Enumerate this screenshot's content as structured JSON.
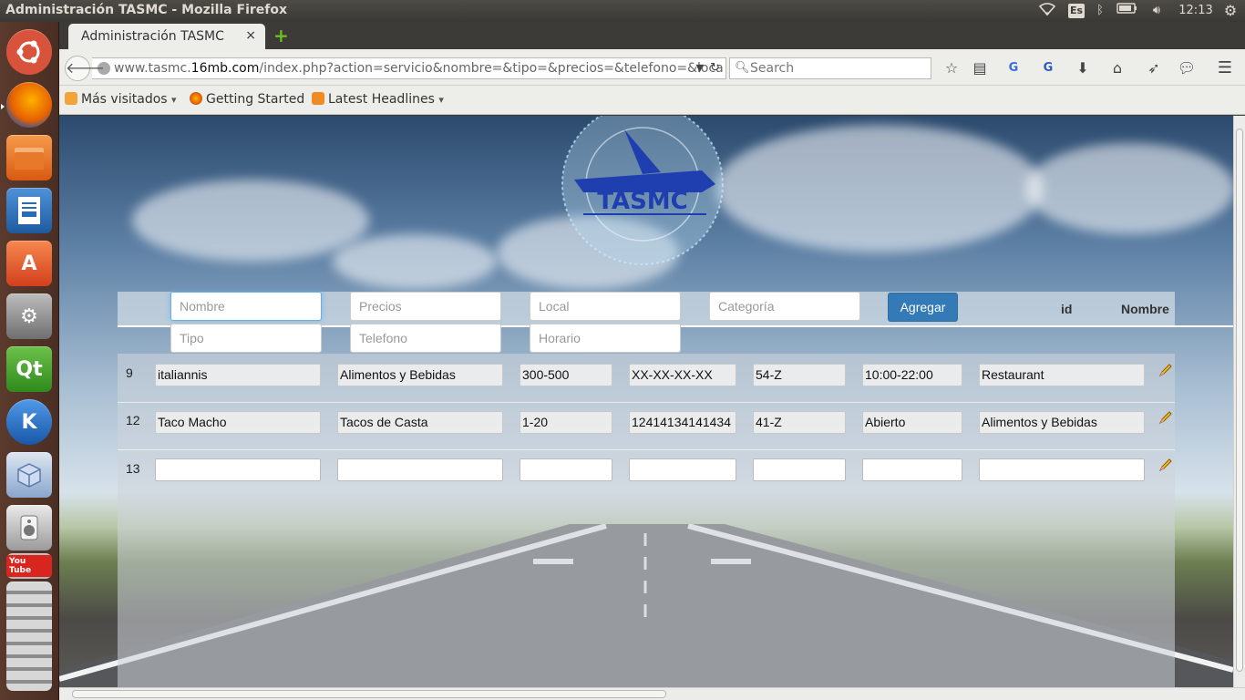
{
  "window": {
    "title": "Administración TASMC - Mozilla Firefox"
  },
  "panel": {
    "keyboard": "Es",
    "time": "12:13"
  },
  "launcher": {
    "items": [
      {
        "name": "ubuntu-dash",
        "color": "#d9533c"
      },
      {
        "name": "firefox",
        "color": "#e66000"
      },
      {
        "name": "files",
        "color": "#e8782a"
      },
      {
        "name": "libreoffice-writer",
        "color": "#2a6cb3"
      },
      {
        "name": "ubuntu-software-center",
        "color": "#e0502e"
      },
      {
        "name": "system-settings",
        "color": "#8a8a8a"
      },
      {
        "name": "qt-creator",
        "color": "#41a02a"
      },
      {
        "name": "kile",
        "color": "#2b74c7"
      },
      {
        "name": "virtualbox",
        "color": "#6b8fbf"
      },
      {
        "name": "speaker",
        "color": "#c9c9c9"
      }
    ],
    "qt_label": "Qt",
    "kile_label": "K",
    "youtube_label": "You Tube"
  },
  "tab": {
    "label": "Administración TASMC",
    "close": "×",
    "new_tab": "+"
  },
  "url": {
    "prefix": "www.tasmc.",
    "domain": "16mb.com",
    "path": "/index.php?action=servicio&nombre=&tipo=&precios=&telefono=&loca"
  },
  "search": {
    "placeholder": "Search"
  },
  "bookmarks": [
    {
      "label": "Más visitados",
      "dropdown": "▾"
    },
    {
      "label": "Getting Started"
    },
    {
      "label": "Latest Headlines",
      "dropdown": "▾"
    }
  ],
  "form": {
    "nombre": "Nombre",
    "precios": "Precios",
    "local": "Local",
    "categoria": "Categoría",
    "tipo": "Tipo",
    "telefono": "Telefono",
    "horario": "Horario",
    "agregar": "Agregar"
  },
  "columns": {
    "id": "id",
    "nombre": "Nombre"
  },
  "logo_text": "TASMC",
  "rows": [
    {
      "id": "9",
      "nombre": "italiannis",
      "tipo": "Alimentos y Bebidas",
      "precios": "300-500",
      "telefono": "XX-XX-XX-XX",
      "local": "54-Z",
      "horario": "10:00-22:00",
      "categoria": "Restaurant"
    },
    {
      "id": "12",
      "nombre": "Taco Macho",
      "tipo": "Tacos de Casta",
      "precios": "1-20",
      "telefono": "12414134141434",
      "local": "41-Z",
      "horario": "Abierto",
      "categoria": "Alimentos y Bebidas"
    },
    {
      "id": "13",
      "nombre": "",
      "tipo": "",
      "precios": "",
      "telefono": "",
      "local": "",
      "horario": "",
      "categoria": ""
    }
  ]
}
